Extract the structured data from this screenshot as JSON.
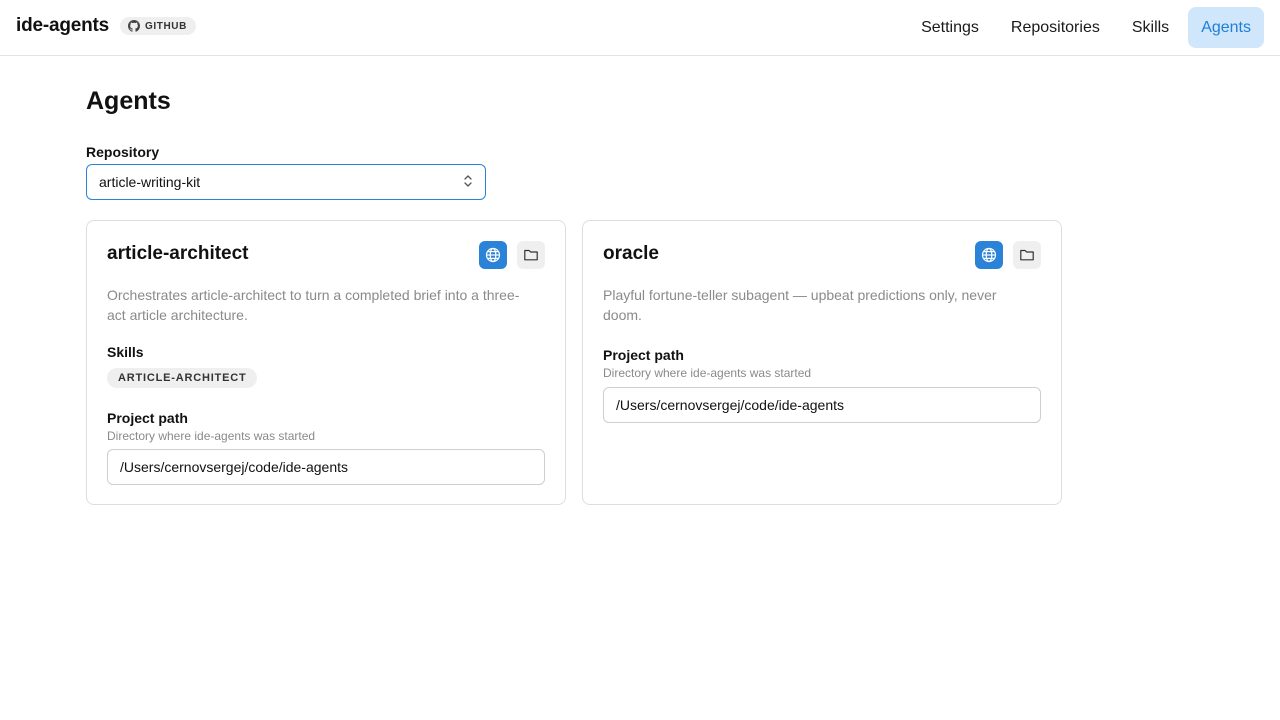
{
  "header": {
    "brand": "ide-agents",
    "badge": {
      "label": "GITHUB",
      "icon": "github-icon"
    },
    "nav": [
      {
        "label": "Settings",
        "active": false
      },
      {
        "label": "Repositories",
        "active": false
      },
      {
        "label": "Skills",
        "active": false
      },
      {
        "label": "Agents",
        "active": true
      }
    ]
  },
  "page": {
    "title": "Agents",
    "repository": {
      "label": "Repository",
      "selected": "article-writing-kit"
    }
  },
  "agents": [
    {
      "name": "article-architect",
      "description": "Orchestrates article-architect to turn a completed brief into a three-act article architecture.",
      "skills_label": "Skills",
      "skills": [
        "ARTICLE-ARCHITECT"
      ],
      "path_label": "Project path",
      "path_help": "Directory where ide-agents was started",
      "path_value": "/Users/cernovsergej/code/ide-agents"
    },
    {
      "name": "oracle",
      "description": "Playful fortune-teller subagent — upbeat predictions only, never doom.",
      "path_label": "Project path",
      "path_help": "Directory where ide-agents was started",
      "path_value": "/Users/cernovsergej/code/ide-agents"
    }
  ],
  "colors": {
    "accent": "#2a83d6",
    "nav_active_bg": "#cfe6fb",
    "nav_active_text": "#1f7ed6",
    "muted_text": "#8a8a8a",
    "chip_bg": "#efefef"
  }
}
